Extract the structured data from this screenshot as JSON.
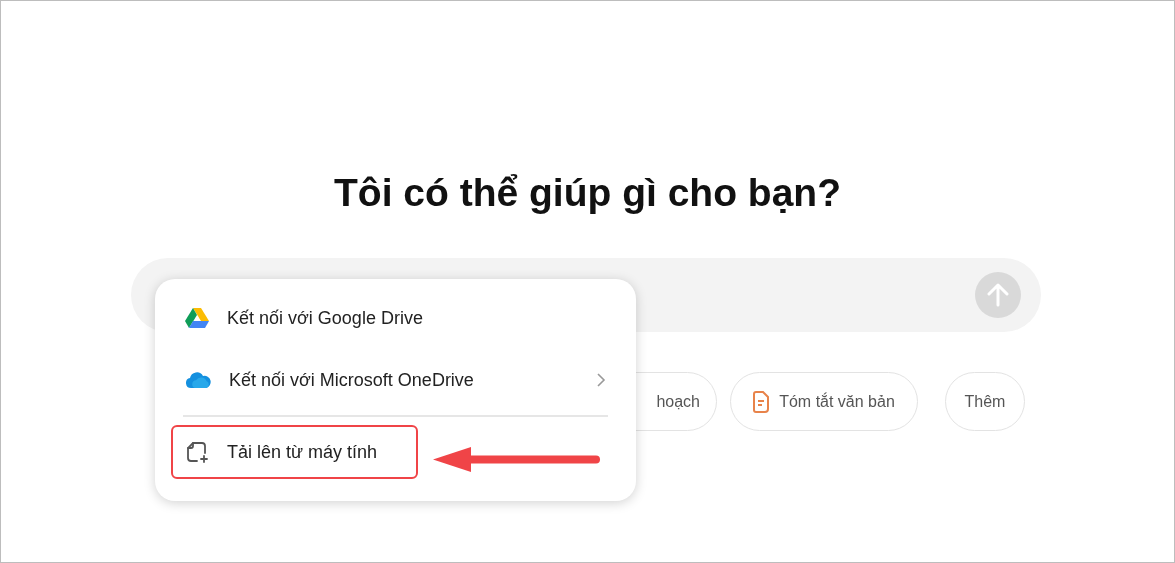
{
  "heading": "Tôi có thể giúp gì cho bạn?",
  "send_button": {
    "disabled": true
  },
  "suggestions": [
    {
      "label": "hoạch",
      "kind": "plain"
    },
    {
      "label": "Tóm tắt văn bản",
      "kind": "document"
    },
    {
      "label": "Thêm",
      "kind": "plain"
    }
  ],
  "attach_menu": {
    "items": [
      {
        "label": "Kết nối với Google Drive",
        "kind": "drive",
        "submenu": false,
        "highlighted": false
      },
      {
        "label": "Kết nối với Microsoft OneDrive",
        "kind": "cloud",
        "submenu": true,
        "highlighted": false
      },
      {
        "label": "Tải lên từ máy tính",
        "kind": "upload",
        "submenu": false,
        "highlighted": true
      }
    ]
  }
}
